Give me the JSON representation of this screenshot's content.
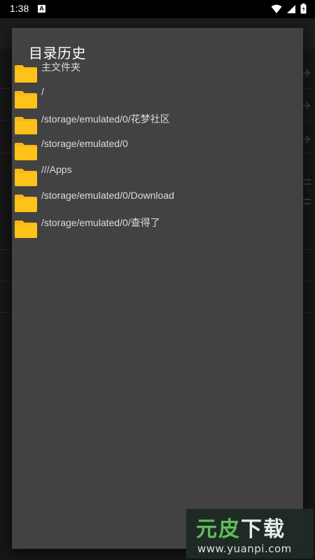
{
  "status_bar": {
    "time": "1:38",
    "notification_badge": "A",
    "icons": [
      "wifi-icon",
      "signal-icon",
      "battery-icon"
    ]
  },
  "dialog": {
    "title": "目录历史",
    "items": [
      {
        "label": "主文件夹",
        "icon": "folder-icon"
      },
      {
        "label": "/",
        "icon": "folder-icon"
      },
      {
        "label": "/storage/emulated/0/花梦社区",
        "icon": "folder-icon"
      },
      {
        "label": "/storage/emulated/0",
        "icon": "folder-icon"
      },
      {
        "label": "///Apps",
        "icon": "folder-icon"
      },
      {
        "label": "/storage/emulated/0/Download",
        "icon": "folder-icon"
      },
      {
        "label": "/storage/emulated/0/查得了",
        "icon": "folder-icon"
      }
    ]
  },
  "watermark": {
    "brand_part1": "元皮",
    "brand_part2": "下载",
    "url": "www.yuanpi.com"
  },
  "colors": {
    "dialog_bg": "#424242",
    "folder": "#F9B915",
    "watermark_green": "#5FC45A"
  }
}
